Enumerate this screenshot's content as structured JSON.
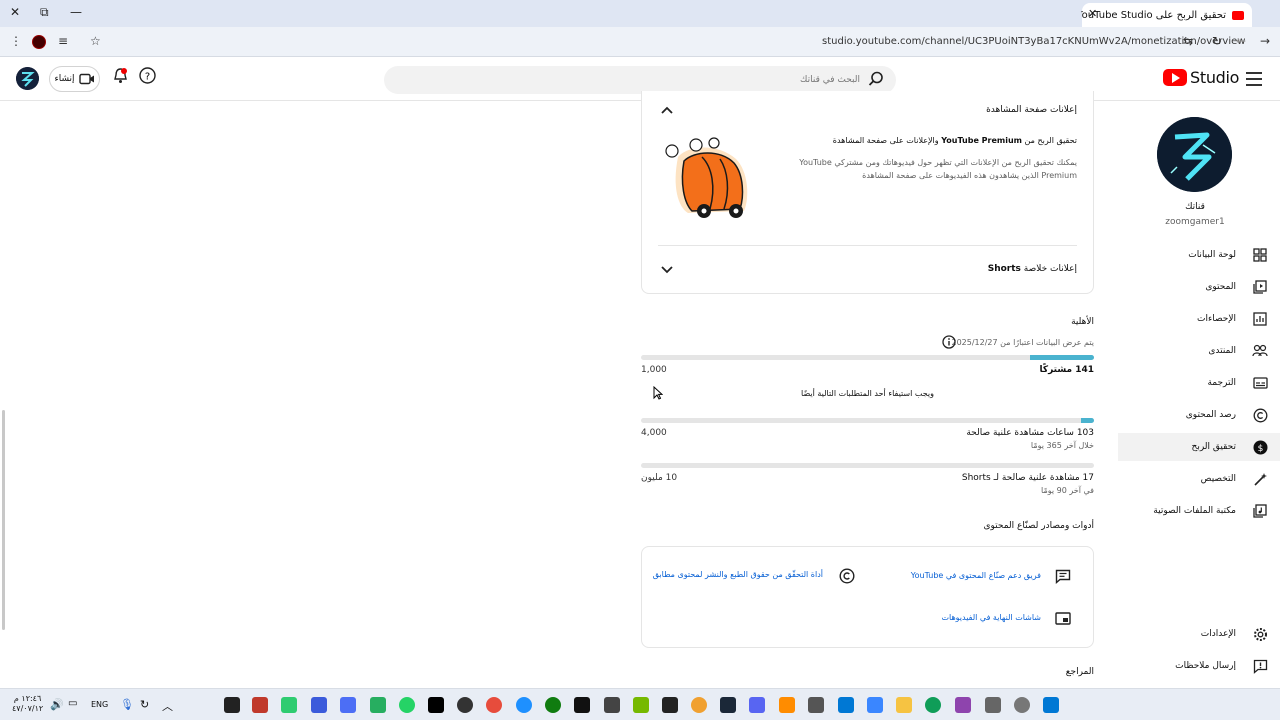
{
  "browser": {
    "tab_title": "تحقيق الربح على YouTube Studio",
    "url": "studio.youtube.com/channel/UC3PUoiNT3yBa17cKNUmWv2A/monetization/overview"
  },
  "header": {
    "logo_text": "Studio",
    "search_placeholder": "البحث في قناتك",
    "create_label": "إنشاء"
  },
  "sidebar": {
    "channel_name": "قناتك",
    "channel_handle": "zoomgamer1",
    "items": [
      {
        "label": "لوحة البيانات",
        "icon": "dashboard-icon"
      },
      {
        "label": "المحتوى",
        "icon": "content-icon"
      },
      {
        "label": "الإحصاءات",
        "icon": "analytics-icon"
      },
      {
        "label": "المنتدى",
        "icon": "community-icon"
      },
      {
        "label": "الترجمة",
        "icon": "subtitles-icon"
      },
      {
        "label": "رصد المحتوى",
        "icon": "copyright-icon"
      },
      {
        "label": "تحقيق الربح",
        "icon": "dollar-icon"
      },
      {
        "label": "التخصيص",
        "icon": "customization-icon"
      },
      {
        "label": "مكتبة الملفات الصوتية",
        "icon": "audio-library-icon"
      }
    ],
    "settings_label": "الإعدادات",
    "feedback_label": "إرسال ملاحظات"
  },
  "watch_ads": {
    "header": "إعلانات صفحة المشاهدة",
    "premium_title_pre": "تحقيق الربح من ",
    "premium_title_brand": "YouTube Premium",
    "premium_title_post": " والإعلانات على صفحة المشاهدة",
    "premium_desc": "يمكنك تحقيق الربح من الإعلانات التي تظهر حول فيديوهاتك ومن مشتركي YouTube Premium الذين يشاهدون هذه الفيديوهات على صفحة المشاهدة",
    "shorts_header_pre": "إعلانات خلاصة ",
    "shorts_header_brand": "Shorts"
  },
  "eligibility": {
    "title": "الأهلية",
    "data_date": "يتم عرض البيانات اعتبارًا من 2025/12/27",
    "subscribers": {
      "label": "141 مشتركًا",
      "target": "1,000",
      "progress": 0.141
    },
    "one_of": "ويجب استيفاء أحد المتطلبات التالية أيضًا",
    "watch_hours": {
      "label": "103 ساعات مشاهدة علنية صالحة",
      "sub": "خلال آخر 365 يومًا",
      "target": "4,000",
      "progress": 0.026
    },
    "shorts_views": {
      "label_pre": "17 مشاهدة علنية صالحة لـ ",
      "label_brand": "Shorts",
      "sub": "في آخر 90 يومًا",
      "target": "10 مليون",
      "progress": 0.0
    }
  },
  "tools": {
    "title": "أدوات ومصادر لصنّاع المحتوى",
    "creator_support": "فريق دعم صنّاع المحتوى في YouTube",
    "copyright_tool": "أداة التحقّق من حقوق الطبع والنشر لمحتوى مطابق",
    "end_screens": "شاشات النهاية في الفيديوهات"
  },
  "reviews_title": "المراجع",
  "taskbar": {
    "lang": "ENG",
    "time": "١٢:٤٦ م",
    "date": "٤٧/٠٧/١٢"
  }
}
